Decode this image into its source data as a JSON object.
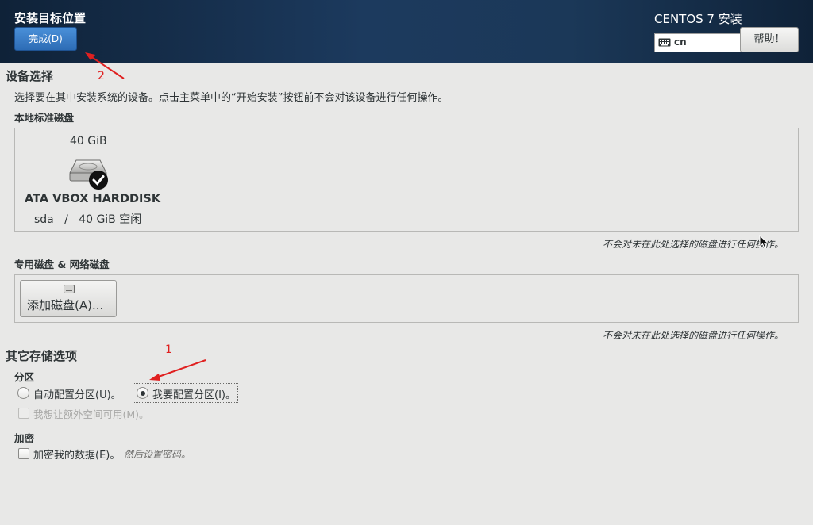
{
  "header": {
    "title": "安装目标位置",
    "done_label": "完成(D)",
    "product": "CENTOS 7 安装",
    "keyboard_layout": "cn",
    "help_label": "帮助！"
  },
  "device_selection": {
    "title": "设备选择",
    "description": "选择要在其中安装系统的设备。点击主菜单中的“开始安装”按钮前不会对该设备进行任何操作。",
    "local_disks_title": "本地标准磁盘",
    "disk": {
      "size": "40 GiB",
      "name": "ATA VBOX HARDDISK",
      "detail": "sda   /   40 GiB 空闲",
      "selected": true
    },
    "local_note": "不会对未在此处选择的磁盘进行任何操作。",
    "special_disks_title": "专用磁盘 & 网络磁盘",
    "add_disk_label": "添加磁盘(A)...",
    "special_note": "不会对未在此处选择的磁盘进行任何操作。"
  },
  "other_storage": {
    "title": "其它存储选项",
    "partition_title": "分区",
    "auto_partition_label": "自动配置分区(U)。",
    "manual_partition_label": "我要配置分区(I)。",
    "selected_option": "manual",
    "extra_space_label": "我想让额外空间可用(M)。",
    "encryption_title": "加密",
    "encrypt_label": "加密我的数据(E)。",
    "encrypt_hint": "然后设置密码。"
  },
  "annotations": {
    "step1": "1",
    "step2": "2",
    "color": "#e02020"
  },
  "colors": {
    "header_bg": "#1c3a5e",
    "accent": "#2d6cb5",
    "background": "#e8e8e7"
  }
}
